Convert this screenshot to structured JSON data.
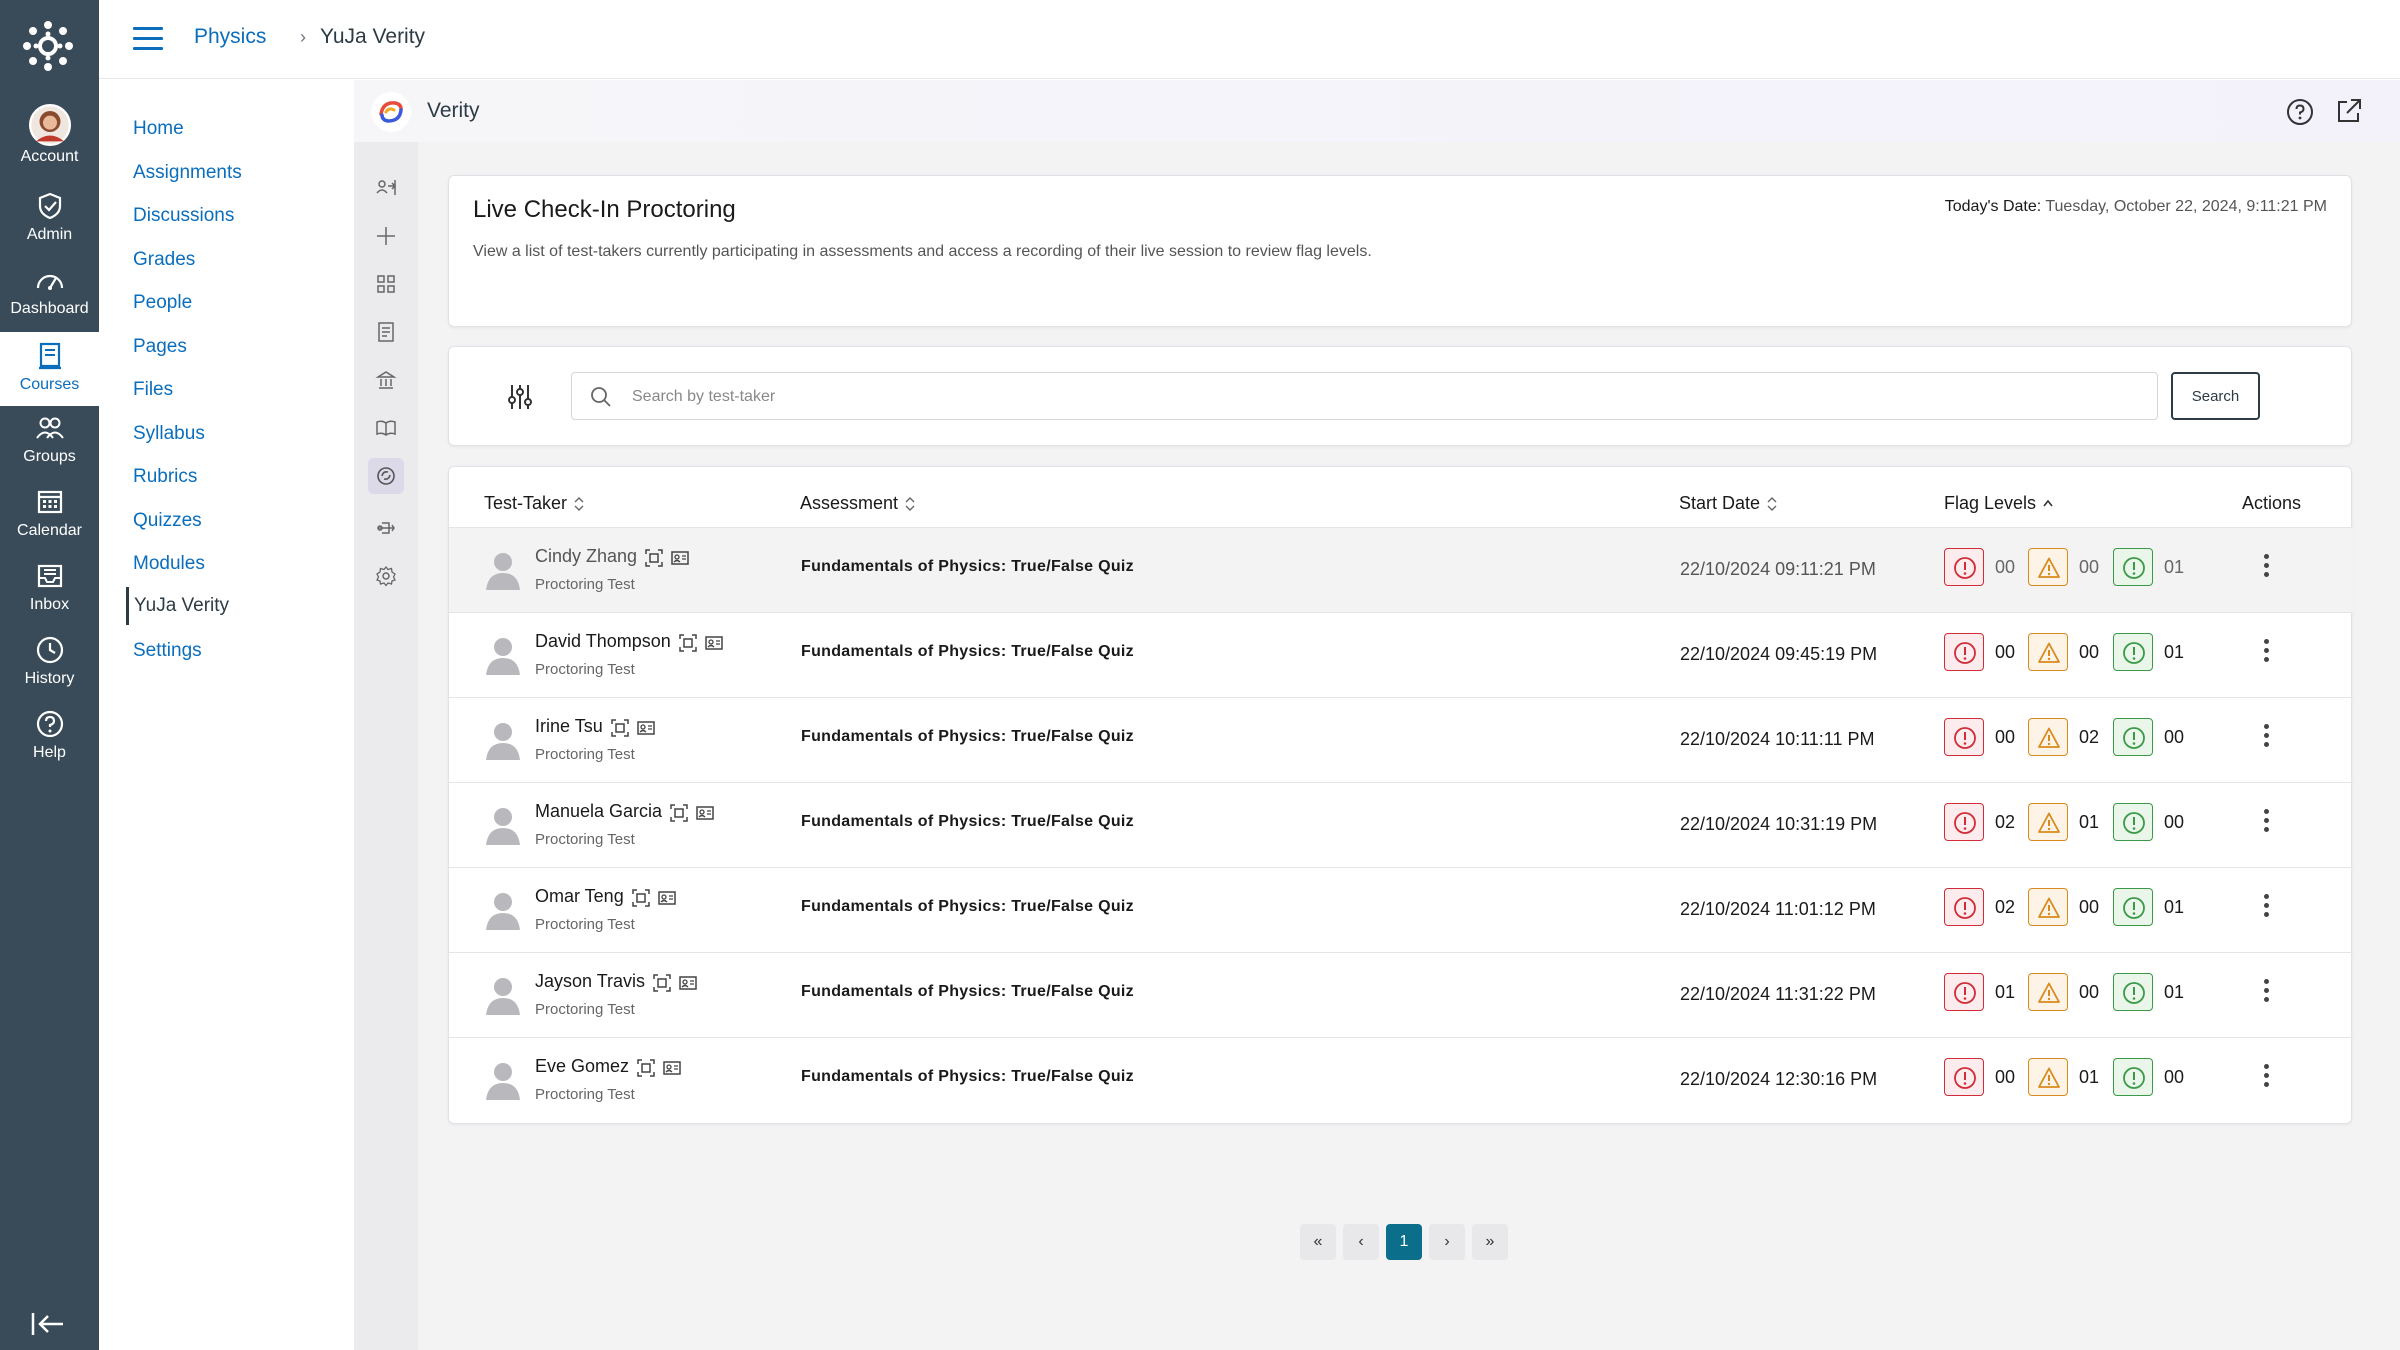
{
  "global_nav": {
    "items": [
      {
        "label": "Account",
        "icon": "avatar-photo"
      },
      {
        "label": "Admin",
        "icon": "shield-icon"
      },
      {
        "label": "Dashboard",
        "icon": "dashboard-icon"
      },
      {
        "label": "Courses",
        "icon": "courses-icon"
      },
      {
        "label": "Groups",
        "icon": "groups-icon"
      },
      {
        "label": "Calendar",
        "icon": "calendar-icon"
      },
      {
        "label": "Inbox",
        "icon": "inbox-icon"
      },
      {
        "label": "History",
        "icon": "history-icon"
      },
      {
        "label": "Help",
        "icon": "help-icon"
      }
    ],
    "active": "Courses"
  },
  "breadcrumb": {
    "course": "Physics",
    "separator": "›",
    "page": "YuJa Verity"
  },
  "course_nav": {
    "items": [
      "Home",
      "Assignments",
      "Discussions",
      "Grades",
      "People",
      "Pages",
      "Files",
      "Syllabus",
      "Rubrics",
      "Quizzes",
      "Modules",
      "YuJa Verity",
      "Settings"
    ],
    "active": "YuJa Verity"
  },
  "verity": {
    "title": "Verity",
    "live": {
      "title": "Live Check-In Proctoring",
      "description": "View a list of test-takers currently participating in assessments and access a recording of their live session to review flag levels.",
      "date_label": "Today's Date:",
      "date_value": "Tuesday, October 22, 2024, 9:11:21 PM"
    },
    "search": {
      "placeholder": "Search by test-taker",
      "value": "",
      "button": "Search"
    },
    "table": {
      "headers": {
        "test_taker": "Test-Taker",
        "assessment": "Assessment",
        "start_date": "Start Date",
        "flag_levels": "Flag Levels",
        "actions": "Actions"
      },
      "rows": [
        {
          "name": "Cindy Zhang",
          "sub": "Proctoring Test",
          "assessment": "Fundamentals of Physics: True/False Quiz",
          "start": "22/10/2024 09:11:21 PM",
          "high": "00",
          "medium": "00",
          "low": "01"
        },
        {
          "name": "David Thompson",
          "sub": "Proctoring Test",
          "assessment": "Fundamentals of Physics: True/False Quiz",
          "start": "22/10/2024 09:45:19 PM",
          "high": "00",
          "medium": "00",
          "low": "01"
        },
        {
          "name": "Irine Tsu",
          "sub": "Proctoring Test",
          "assessment": "Fundamentals of Physics: True/False Quiz",
          "start": "22/10/2024 10:11:11 PM",
          "high": "00",
          "medium": "02",
          "low": "00"
        },
        {
          "name": "Manuela Garcia",
          "sub": "Proctoring Test",
          "assessment": "Fundamentals of Physics: True/False Quiz",
          "start": "22/10/2024 10:31:19 PM",
          "high": "02",
          "medium": "01",
          "low": "00"
        },
        {
          "name": "Omar Teng",
          "sub": "Proctoring Test",
          "assessment": "Fundamentals of Physics: True/False Quiz",
          "start": "22/10/2024 11:01:12 PM",
          "high": "02",
          "medium": "00",
          "low": "01"
        },
        {
          "name": "Jayson Travis",
          "sub": "Proctoring Test",
          "assessment": "Fundamentals of Physics: True/False Quiz",
          "start": "22/10/2024 11:31:22 PM",
          "high": "01",
          "medium": "00",
          "low": "01"
        },
        {
          "name": "Eve Gomez",
          "sub": "Proctoring Test",
          "assessment": "Fundamentals of Physics: True/False Quiz",
          "start": "22/10/2024 12:30:16 PM",
          "high": "00",
          "medium": "01",
          "low": "00"
        }
      ]
    },
    "pagination": {
      "first": "«",
      "prev": "‹",
      "current": "1",
      "next": "›",
      "last": "»"
    }
  },
  "colors": {
    "nav_bg": "#394b58",
    "link": "#0a6ebd",
    "flag_high": "#d12c38",
    "flag_medium": "#d98a1c",
    "flag_low": "#3b9a47",
    "page_active": "#0b6e8a"
  }
}
